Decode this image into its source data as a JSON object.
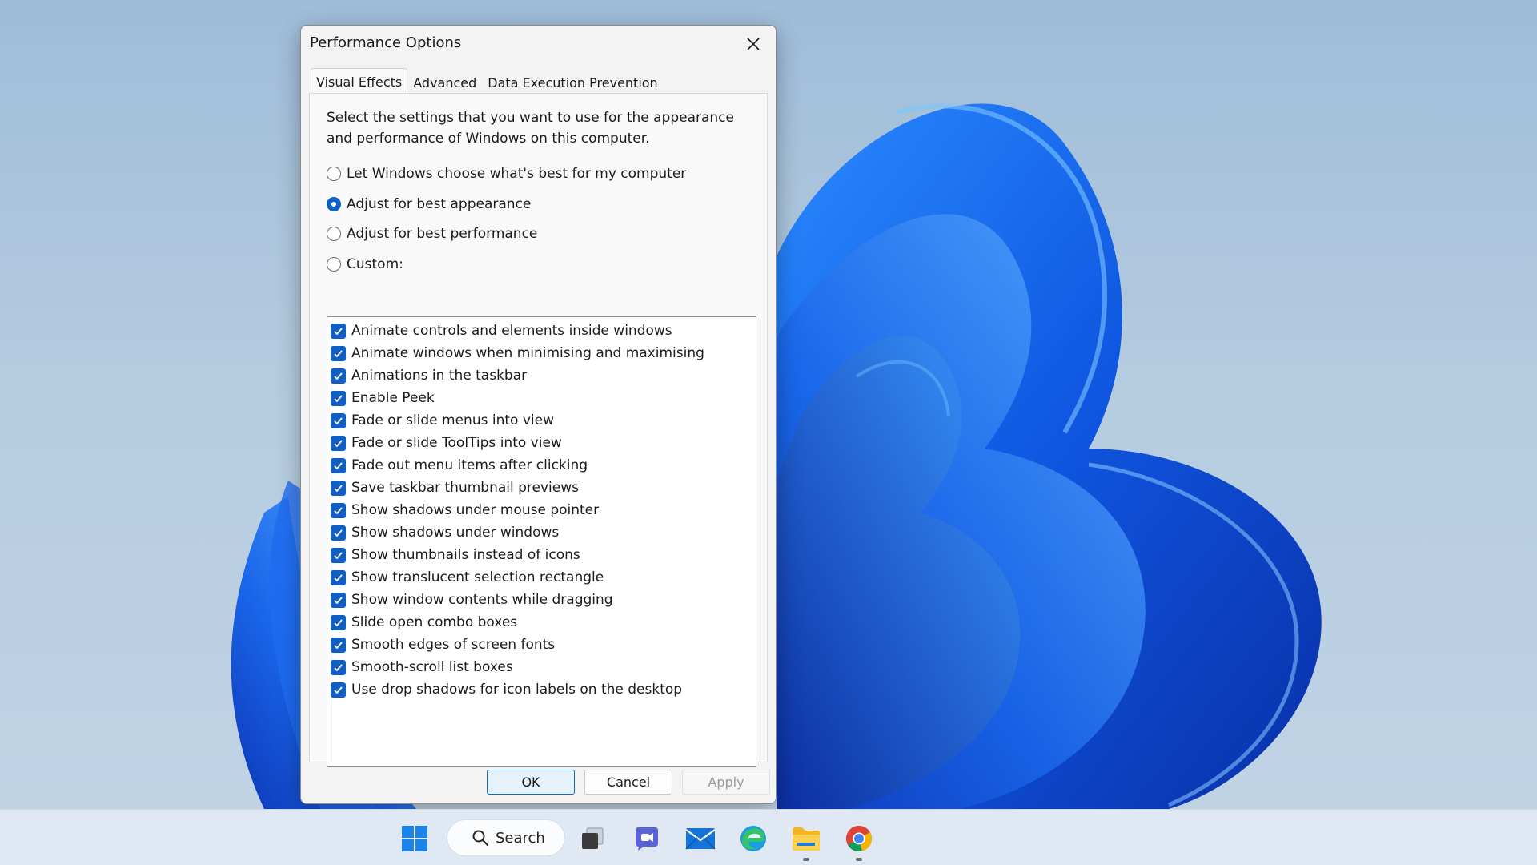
{
  "dialog": {
    "title": "Performance Options",
    "close_label": "close",
    "tabs": [
      {
        "label": "Visual Effects",
        "active": true
      },
      {
        "label": "Advanced",
        "active": false
      },
      {
        "label": "Data Execution Prevention",
        "active": false
      }
    ],
    "description": "Select the settings that you want to use for the appearance and performance of Windows on this computer.",
    "options": [
      {
        "label": "Let Windows choose what's best for my computer",
        "selected": false
      },
      {
        "label": "Adjust for best appearance",
        "selected": true
      },
      {
        "label": "Adjust for best performance",
        "selected": false
      },
      {
        "label": "Custom:",
        "selected": false
      }
    ],
    "effects": [
      {
        "label": "Animate controls and elements inside windows",
        "checked": true
      },
      {
        "label": "Animate windows when minimising and maximising",
        "checked": true
      },
      {
        "label": "Animations in the taskbar",
        "checked": true
      },
      {
        "label": "Enable Peek",
        "checked": true
      },
      {
        "label": "Fade or slide menus into view",
        "checked": true
      },
      {
        "label": "Fade or slide ToolTips into view",
        "checked": true
      },
      {
        "label": "Fade out menu items after clicking",
        "checked": true
      },
      {
        "label": "Save taskbar thumbnail previews",
        "checked": true
      },
      {
        "label": "Show shadows under mouse pointer",
        "checked": true
      },
      {
        "label": "Show shadows under windows",
        "checked": true
      },
      {
        "label": "Show thumbnails instead of icons",
        "checked": true
      },
      {
        "label": "Show translucent selection rectangle",
        "checked": true
      },
      {
        "label": "Show window contents while dragging",
        "checked": true
      },
      {
        "label": "Slide open combo boxes",
        "checked": true
      },
      {
        "label": "Smooth edges of screen fonts",
        "checked": true
      },
      {
        "label": "Smooth-scroll list boxes",
        "checked": true
      },
      {
        "label": "Use drop shadows for icon labels on the desktop",
        "checked": true
      }
    ],
    "buttons": {
      "ok": "OK",
      "cancel": "Cancel",
      "apply": "Apply"
    }
  },
  "taskbar": {
    "search_label": "Search",
    "items": [
      "start-icon",
      "search-icon",
      "task-view-icon",
      "chat-icon",
      "mail-icon",
      "edge-icon",
      "file-explorer-icon",
      "chrome-icon"
    ]
  },
  "colors": {
    "accent": "#0f5fc4",
    "wallpaper_bg": "#b5cce0",
    "taskbar_bg": "#dfe8f3"
  }
}
